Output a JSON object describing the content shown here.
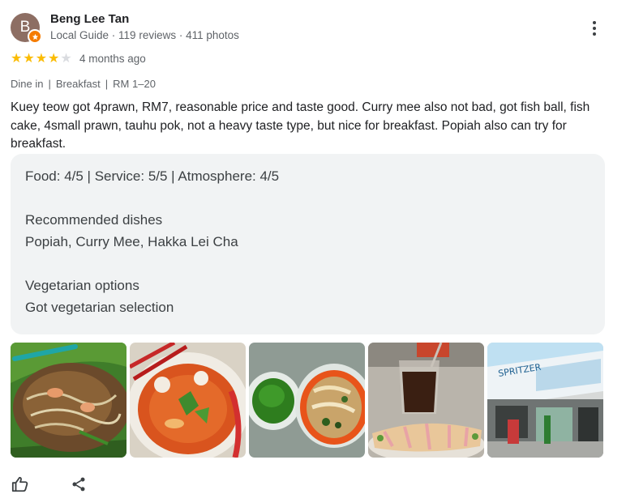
{
  "reviewer": {
    "initial": "B",
    "name": "Beng Lee Tan",
    "meta": "Local Guide · 119 reviews · 411 photos",
    "avatar_color": "#8d6e63",
    "badge_color": "#f57c00"
  },
  "rating": {
    "stars": 4,
    "max": 5,
    "star_color": "#fbbc04"
  },
  "time_ago": "4 months ago",
  "tags": [
    "Dine in",
    "Breakfast",
    "RM 1–20"
  ],
  "review_text": "Kuey teow got 4prawn, RM7, reasonable price and taste good. Curry mee also not bad, got fish ball, fish cake, 4small prawn, tauhu pok, not a heavy taste type, but nice for breakfast. Popiah also can try for breakfast.",
  "details": {
    "ratings_line": "Food: 4/5  |  Service: 5/5  |  Atmosphere: 4/5",
    "recommended_heading": "Recommended dishes",
    "recommended_value": "Popiah, Curry Mee, Hakka Lei Cha",
    "vegetarian_heading": "Vegetarian options",
    "vegetarian_value": "Got vegetarian selection"
  },
  "photos": [
    {
      "subject": "kuey-teow-photo"
    },
    {
      "subject": "curry-mee-photo"
    },
    {
      "subject": "lei-cha-photo"
    },
    {
      "subject": "coffee-popiah-photo"
    },
    {
      "subject": "shopfront-photo",
      "sign_text": "SPRITZER"
    }
  ],
  "actions": {
    "like_icon": "thumb-up-icon",
    "share_icon": "share-icon"
  }
}
